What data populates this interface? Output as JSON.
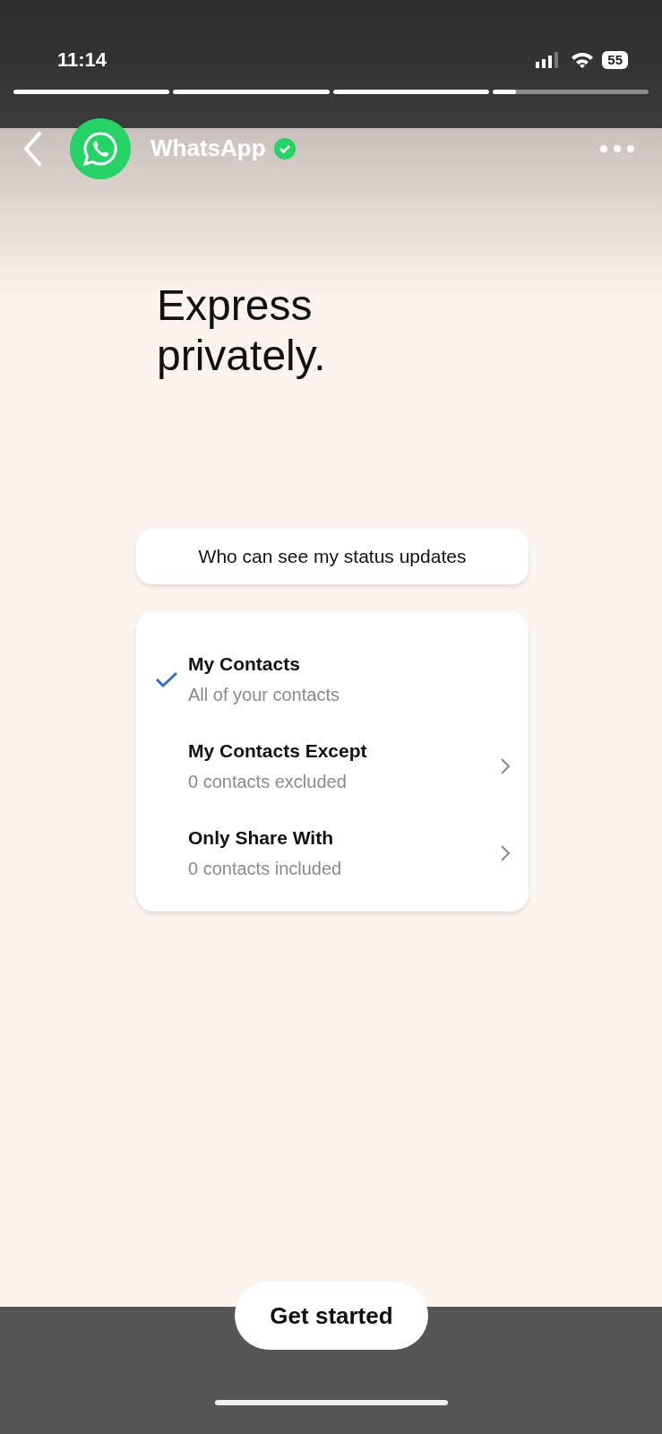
{
  "status_bar": {
    "time": "11:14",
    "battery": "55"
  },
  "story_progress": [
    {
      "level": 1
    },
    {
      "level": 1
    },
    {
      "level": 1
    },
    {
      "level": 0.15
    }
  ],
  "header": {
    "account": "WhatsApp",
    "verified": true
  },
  "headline": "Express privately.",
  "privacy_card": {
    "title": "Who can see my status updates",
    "options": [
      {
        "label": "My Contacts",
        "description": "All of your contacts",
        "selected": true,
        "chevron": false
      },
      {
        "label": "My Contacts Except",
        "description": "0 contacts excluded",
        "selected": false,
        "chevron": true
      },
      {
        "label": "Only Share With",
        "description": "0 contacts included",
        "selected": false,
        "chevron": true
      }
    ]
  },
  "cta_button": "Get started"
}
